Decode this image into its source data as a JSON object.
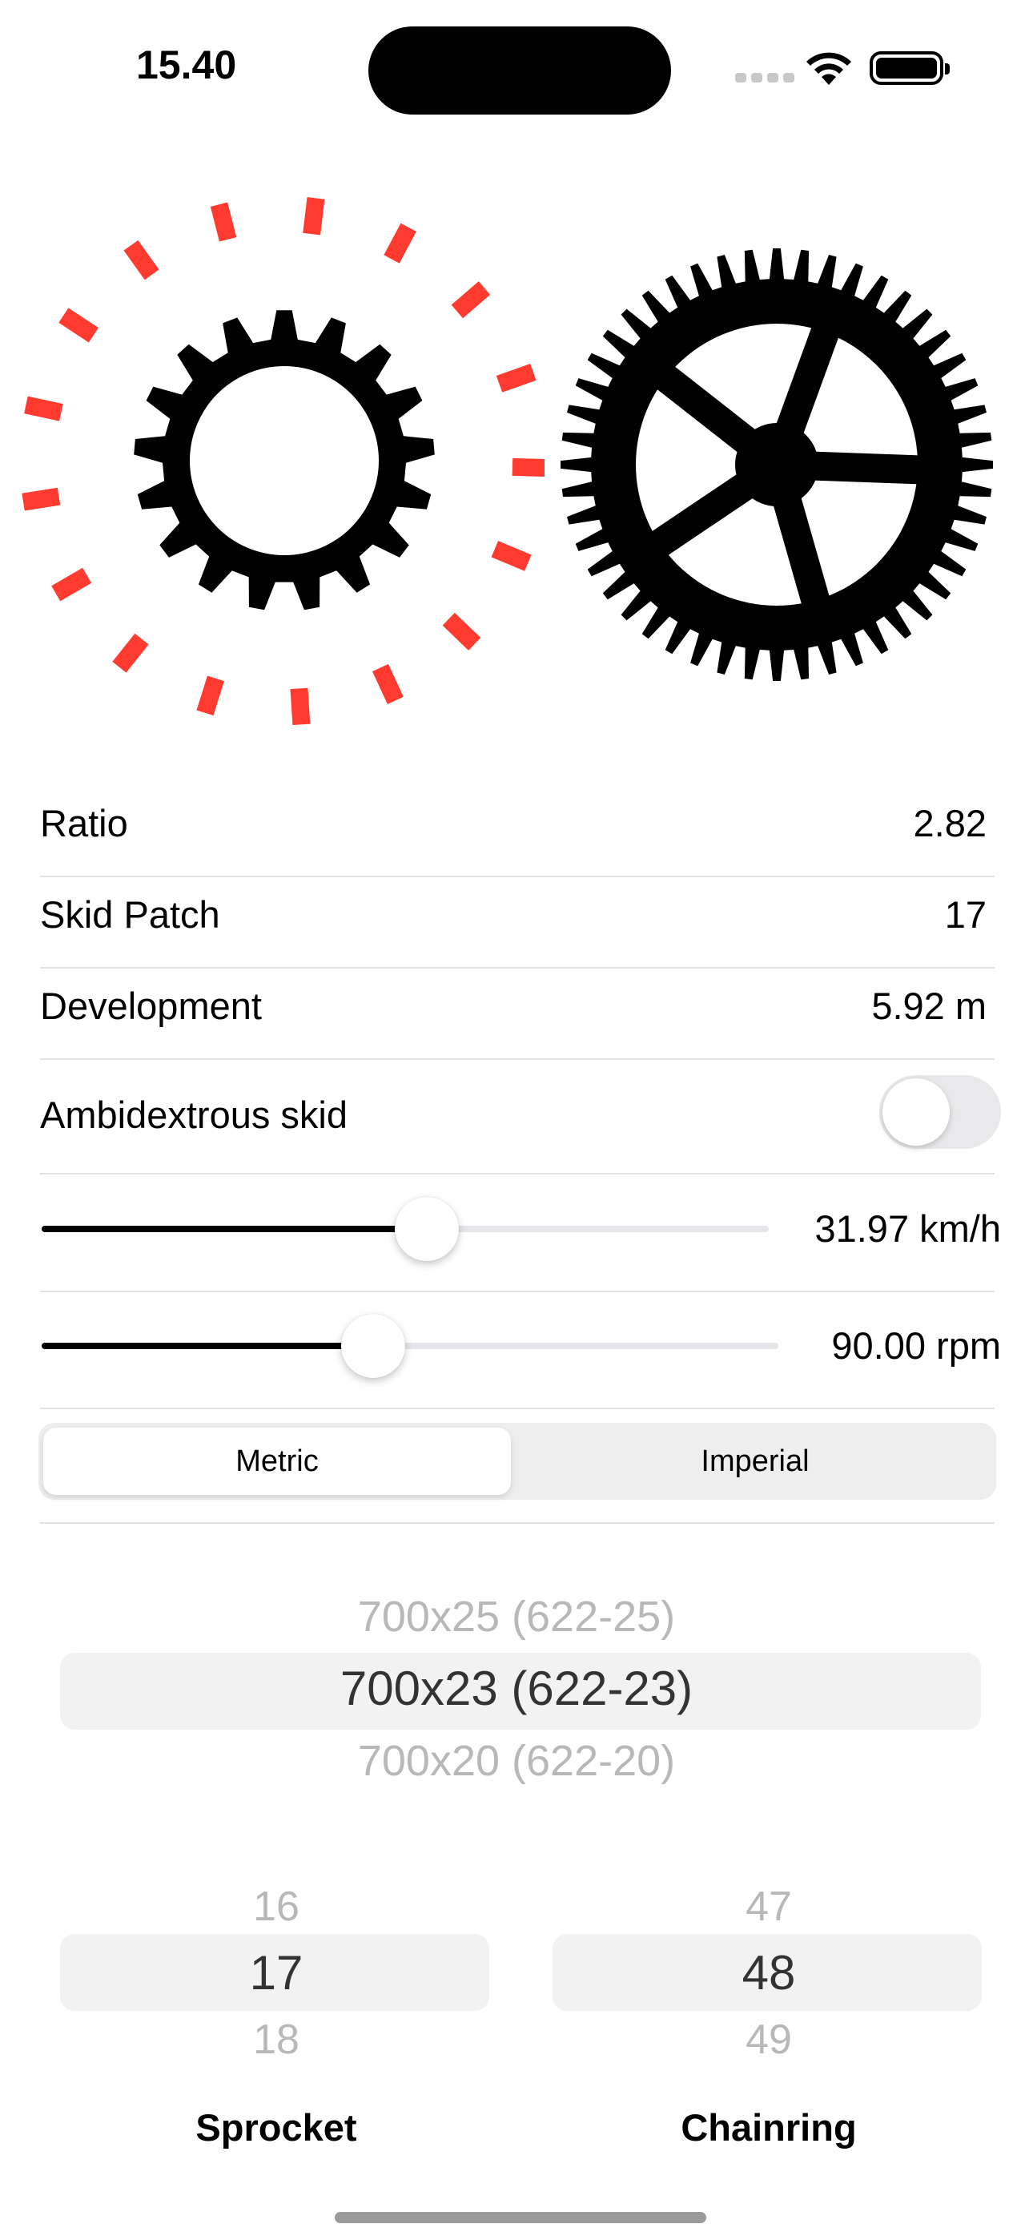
{
  "status_bar": {
    "time": "15.40"
  },
  "gears": {
    "sprocket": {
      "teeth": 17,
      "skid_patches": 17,
      "mark_color": "#ff3b30"
    },
    "chainring": {
      "teeth": 48,
      "spokes": 5
    }
  },
  "stats": {
    "ratio": {
      "label": "Ratio",
      "value": "2.82"
    },
    "skid_patch": {
      "label": "Skid Patch",
      "value": "17"
    },
    "development": {
      "label": "Development",
      "value": "5.92 m"
    }
  },
  "ambidextrous": {
    "label": "Ambidextrous skid",
    "enabled": false
  },
  "speed_slider": {
    "value": "31.97 km/h",
    "fraction": 0.53
  },
  "cadence_slider": {
    "value": "90.00 rpm",
    "fraction": 0.45
  },
  "units": {
    "options": [
      "Metric",
      "Imperial"
    ],
    "selected": "Metric"
  },
  "tire_picker": {
    "items": [
      "700x25 (622-25)",
      "700x23 (622-23)",
      "700x20 (622-20)"
    ],
    "selected": "700x23 (622-23)"
  },
  "sprocket_picker": {
    "items": [
      "16",
      "17",
      "18"
    ],
    "selected": "17",
    "label": "Sprocket"
  },
  "chainring_picker": {
    "items": [
      "47",
      "48",
      "49"
    ],
    "selected": "48",
    "label": "Chainring"
  }
}
